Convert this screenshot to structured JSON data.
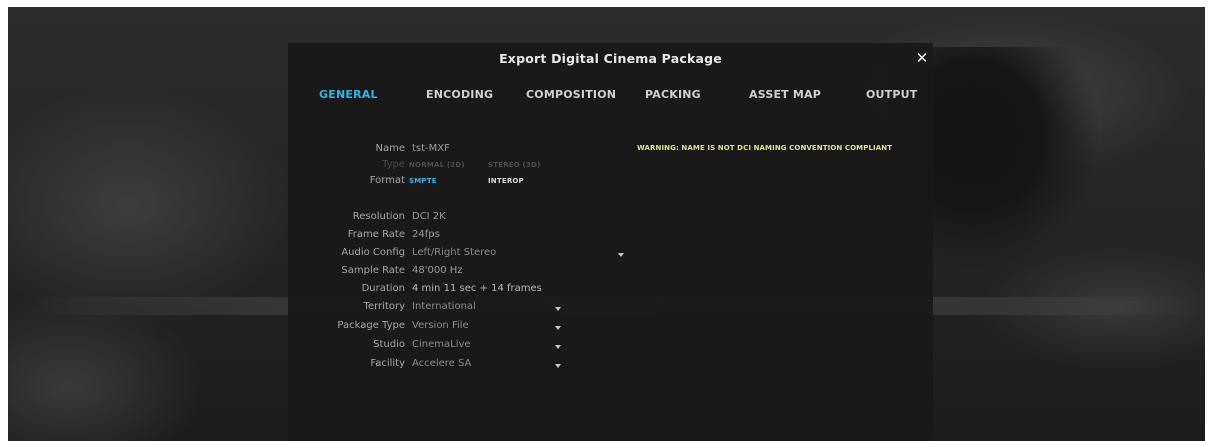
{
  "dialog": {
    "title": "Export Digital Cinema Package",
    "close_glyph": "✕"
  },
  "tabs": [
    {
      "label": "GENERAL",
      "active": true
    },
    {
      "label": "ENCODING",
      "active": false
    },
    {
      "label": "COMPOSITION",
      "active": false
    },
    {
      "label": "PACKING",
      "active": false
    },
    {
      "label": "ASSET MAP",
      "active": false
    },
    {
      "label": "OUTPUT",
      "active": false
    }
  ],
  "general": {
    "name": {
      "label": "Name",
      "value": "tst-MXF"
    },
    "type": {
      "label": "Type",
      "options": [
        "NORMAL (2D)",
        "STEREO (3D)"
      ],
      "enabled": false
    },
    "format": {
      "label": "Format",
      "options": [
        "SMPTE",
        "INTEROP"
      ],
      "selected": "SMPTE"
    },
    "warning": "WARNING: NAME IS NOT DCI NAMING CONVENTION COMPLIANT",
    "resolution": {
      "label": "Resolution",
      "value": "DCI 2K"
    },
    "frame_rate": {
      "label": "Frame Rate",
      "value": "24fps"
    },
    "audio_config": {
      "label": "Audio Config",
      "value": "Left/Right Stereo"
    },
    "sample_rate": {
      "label": "Sample Rate",
      "value": "48'000 Hz"
    },
    "duration": {
      "label": "Duration",
      "value": "4 min 11 sec + 14 frames"
    },
    "territory": {
      "label": "Territory",
      "value": "International"
    },
    "package_type": {
      "label": "Package Type",
      "value": "Version File"
    },
    "studio": {
      "label": "Studio",
      "value": "CinemaLive"
    },
    "facility": {
      "label": "Facility",
      "value": "Accelere SA"
    }
  },
  "colors": {
    "accent": "#33b5e5",
    "warning": "#e6e08a",
    "dialog_bg": "#181818"
  }
}
